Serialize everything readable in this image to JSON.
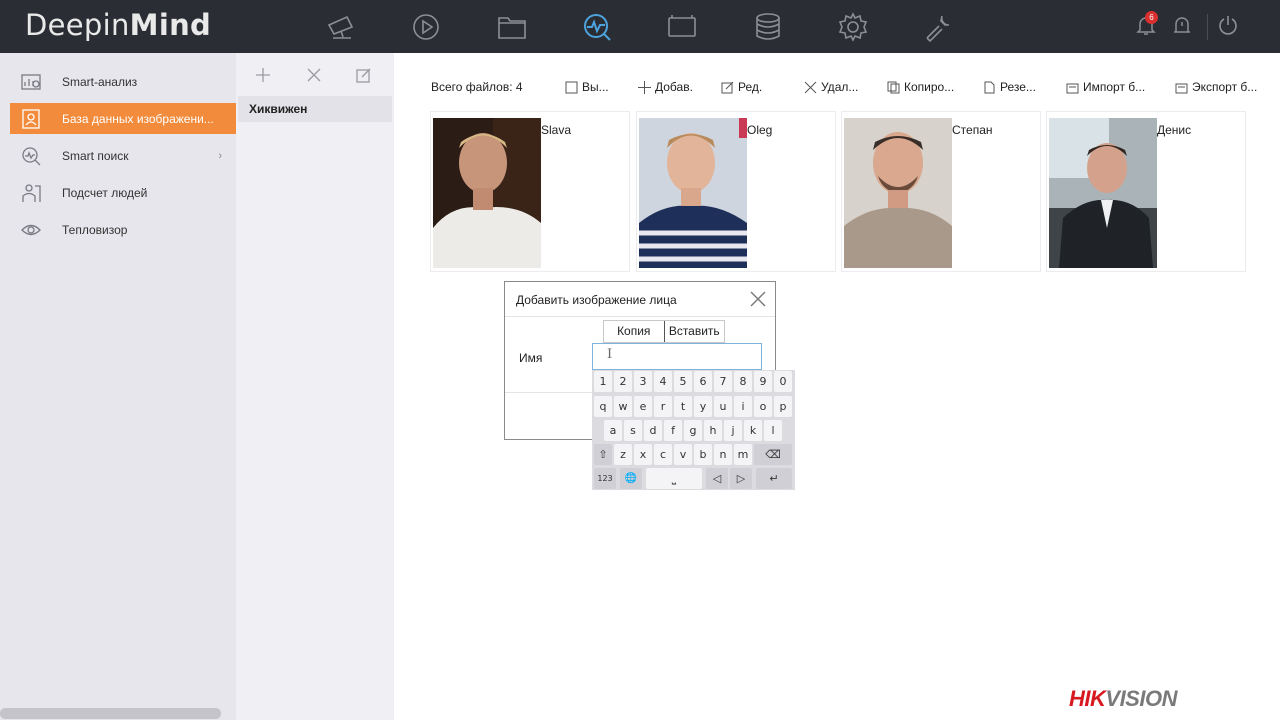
{
  "app": {
    "logo_regular": "Deepin",
    "logo_bold": "Mind"
  },
  "topbar": {
    "icons": [
      "camera-icon",
      "playback-icon",
      "folder-icon",
      "smart-analysis-icon",
      "display-icon",
      "storage-icon",
      "settings-icon",
      "maintenance-icon"
    ],
    "active_icon": "smart-analysis-icon",
    "notification_count": "6",
    "accent": "#4da3dd"
  },
  "sidebar": {
    "items": [
      {
        "label": "Smart-анализ",
        "icon": "analysis-icon"
      },
      {
        "label": "База данных изображени...",
        "icon": "face-database-icon",
        "active": true
      },
      {
        "label": "Smart поиск",
        "icon": "smart-search-icon",
        "chevron": "›"
      },
      {
        "label": "Подсчет людей",
        "icon": "people-counting-icon"
      },
      {
        "label": "Тепловизор",
        "icon": "heat-map-icon"
      }
    ],
    "active_color": "#f28b3b"
  },
  "library": {
    "items": [
      "Хиквижен"
    ]
  },
  "toolbar": {
    "count_label": "Всего файлов: 4",
    "select_label": "Вы...",
    "add_label": "Добав.",
    "edit_label": "Ред.",
    "delete_label": "Удал...",
    "copy_label": "Копиро...",
    "backup_label": "Резе...",
    "import_label": "Импорт б...",
    "export_label": "Экспорт б..."
  },
  "faces": [
    {
      "name": "Slava"
    },
    {
      "name": "Oleg"
    },
    {
      "name": "Степан"
    },
    {
      "name": "Денис"
    }
  ],
  "dialog": {
    "title": "Добавить изображение лица",
    "copy_label": "Копия",
    "paste_label": "Вставить",
    "name_label": "Имя",
    "name_value": ""
  },
  "keyboard": {
    "row1": [
      "1",
      "2",
      "3",
      "4",
      "5",
      "6",
      "7",
      "8",
      "9",
      "0"
    ],
    "row2": [
      "q",
      "w",
      "e",
      "r",
      "t",
      "y",
      "u",
      "i",
      "o",
      "p"
    ],
    "row3": [
      "a",
      "s",
      "d",
      "f",
      "g",
      "h",
      "j",
      "k",
      "l"
    ],
    "row4": [
      "z",
      "x",
      "c",
      "v",
      "b",
      "n",
      "m"
    ],
    "shift": "⇧",
    "backspace": "⌫",
    "mode": "123",
    "globe": "🌐",
    "space": "⎵",
    "left": "◁",
    "right": "▷",
    "enter": "↵"
  },
  "brand": {
    "red": "HIK",
    "grey": "VISION",
    "color": "#d71920"
  }
}
